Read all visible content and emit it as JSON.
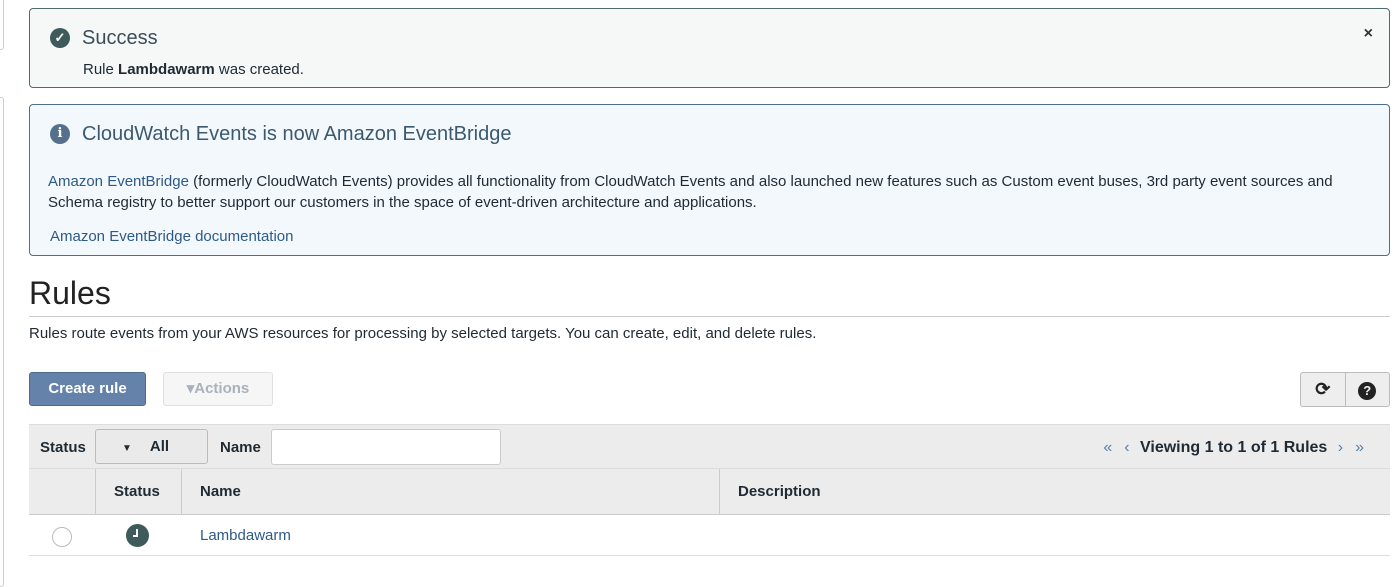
{
  "success": {
    "title": "Success",
    "prefix": "Rule ",
    "rule": "Lambdawarm",
    "suffix": " was created.",
    "close": "×"
  },
  "info": {
    "title": "CloudWatch Events is now Amazon EventBridge",
    "link": "Amazon EventBridge",
    "body": " (formerly CloudWatch Events) provides all functionality from CloudWatch Events and also launched new features such as Custom event buses, 3rd party event sources and Schema registry to better support our customers in the space of event-driven architecture and applications.",
    "doc_link": "Amazon EventBridge documentation"
  },
  "page": {
    "title": "Rules",
    "description": "Rules route events from your AWS resources for processing by selected targets. You can create, edit, and delete rules."
  },
  "toolbar": {
    "create": "Create rule",
    "actions": "▾Actions",
    "refresh": "⟳",
    "help": "?"
  },
  "filter": {
    "status_label": "Status",
    "status_value": "All",
    "name_label": "Name",
    "name_value": "",
    "pagination": "Viewing 1 to 1 of 1 Rules",
    "first": "«",
    "prev": "‹",
    "next": "›",
    "last": "»"
  },
  "table": {
    "columns": [
      "Status",
      "Name",
      "Description"
    ],
    "rows": [
      {
        "status": "scheduled",
        "name": "Lambdawarm",
        "description": ""
      }
    ]
  }
}
